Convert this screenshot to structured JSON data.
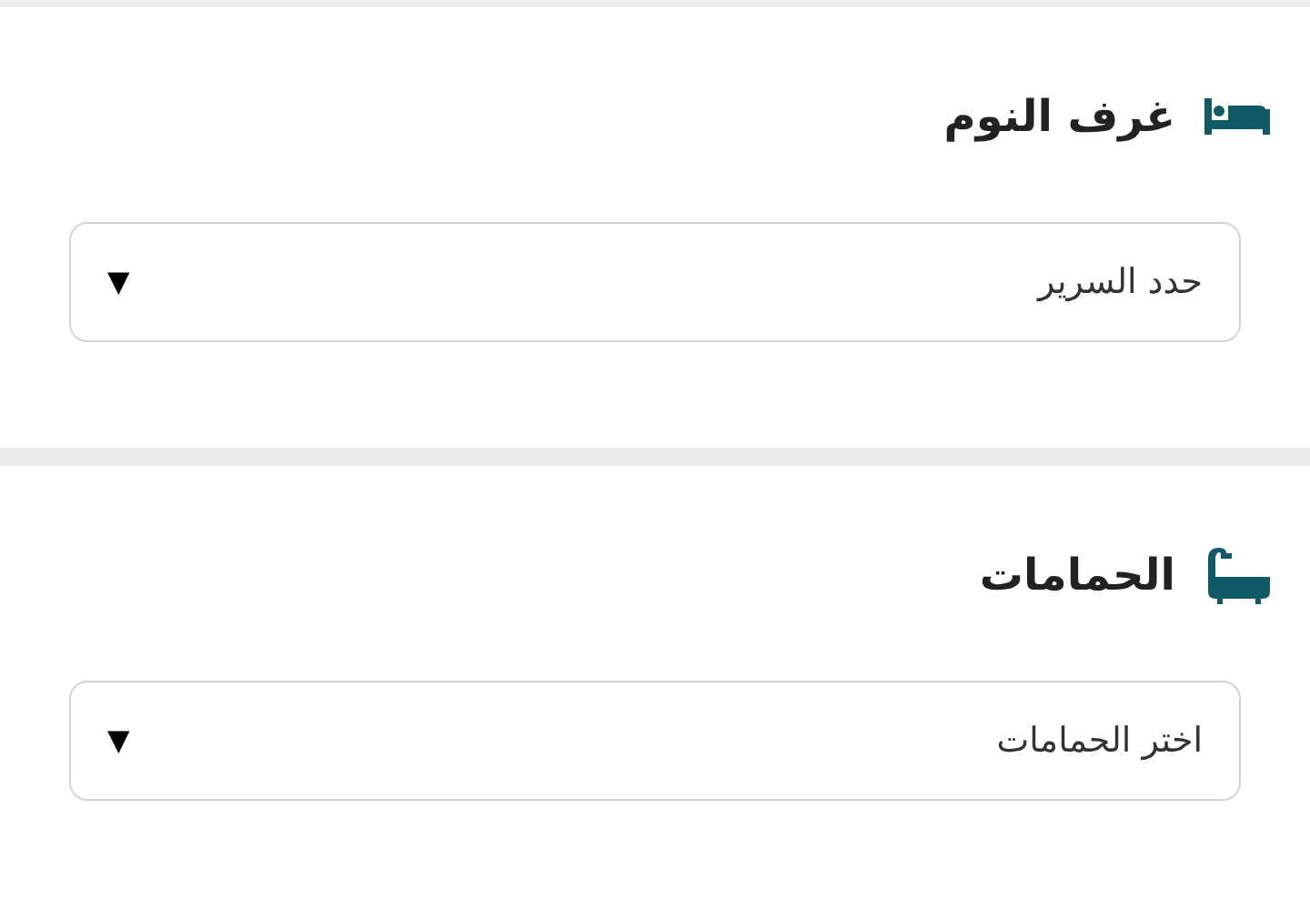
{
  "sections": [
    {
      "kind": "bed",
      "title": "غرف النوم",
      "select": {
        "placeholder": "حدد السرير",
        "arrow": "▼"
      }
    },
    {
      "kind": "bath",
      "title": "الحمامات",
      "select": {
        "placeholder": "اختر الحمامات",
        "arrow": "▼"
      }
    }
  ]
}
